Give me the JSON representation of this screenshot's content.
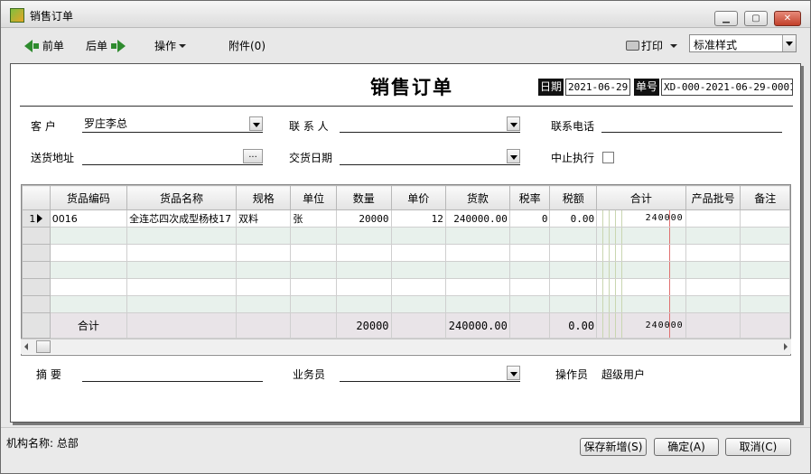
{
  "window": {
    "title": "销售订单"
  },
  "toolbar": {
    "prev_label": "前单",
    "next_label": "后单",
    "operate_label": "操作",
    "attach_label": "附件(0)",
    "print_label": "打印",
    "style_value": "标准样式"
  },
  "header": {
    "doc_title": "销售订单",
    "date_label": "日期",
    "date_value": "2021-06-29",
    "no_label": "单号",
    "no_value": "XD-000-2021-06-29-0001"
  },
  "form": {
    "customer_label": "客    户",
    "customer_value": "罗庄李总",
    "contact_label": "联 系 人",
    "contact_value": "",
    "phone_label": "联系电话",
    "phone_value": "",
    "address_label": "送货地址",
    "address_value": "",
    "delivery_date_label": "交货日期",
    "delivery_date_value": "",
    "stop_label": "中止执行",
    "ellipsis_label": "..."
  },
  "grid": {
    "columns": [
      "",
      "货品编码",
      "货品名称",
      "规格",
      "单位",
      "数量",
      "单价",
      "货款",
      "税率",
      "税额",
      "合计",
      "产品批号",
      "备注"
    ],
    "rows": [
      {
        "no": "1",
        "code": "0016",
        "name": "全连芯四次成型杨枝17",
        "spec": "双料",
        "unit": "张",
        "qty": "20000",
        "price": "12",
        "amount": "240000.00",
        "tax_rate": "0",
        "tax": "0.00",
        "total": "240000",
        "batch": "",
        "remark": ""
      }
    ],
    "total_row": {
      "label": "合计",
      "qty": "20000",
      "amount": "240000.00",
      "tax": "0.00",
      "total": "240000"
    }
  },
  "footer_form": {
    "summary_label": "摘    要",
    "summary_value": "",
    "salesman_label": "业务员",
    "salesman_value": "",
    "operator_label": "操作员",
    "operator_value": "超级用户"
  },
  "status": {
    "org_label": "机构名称:",
    "org_value": "总部",
    "save_new_label": "保存新增(S)",
    "ok_label": "确定(A)",
    "cancel_label": "取消(C)"
  }
}
